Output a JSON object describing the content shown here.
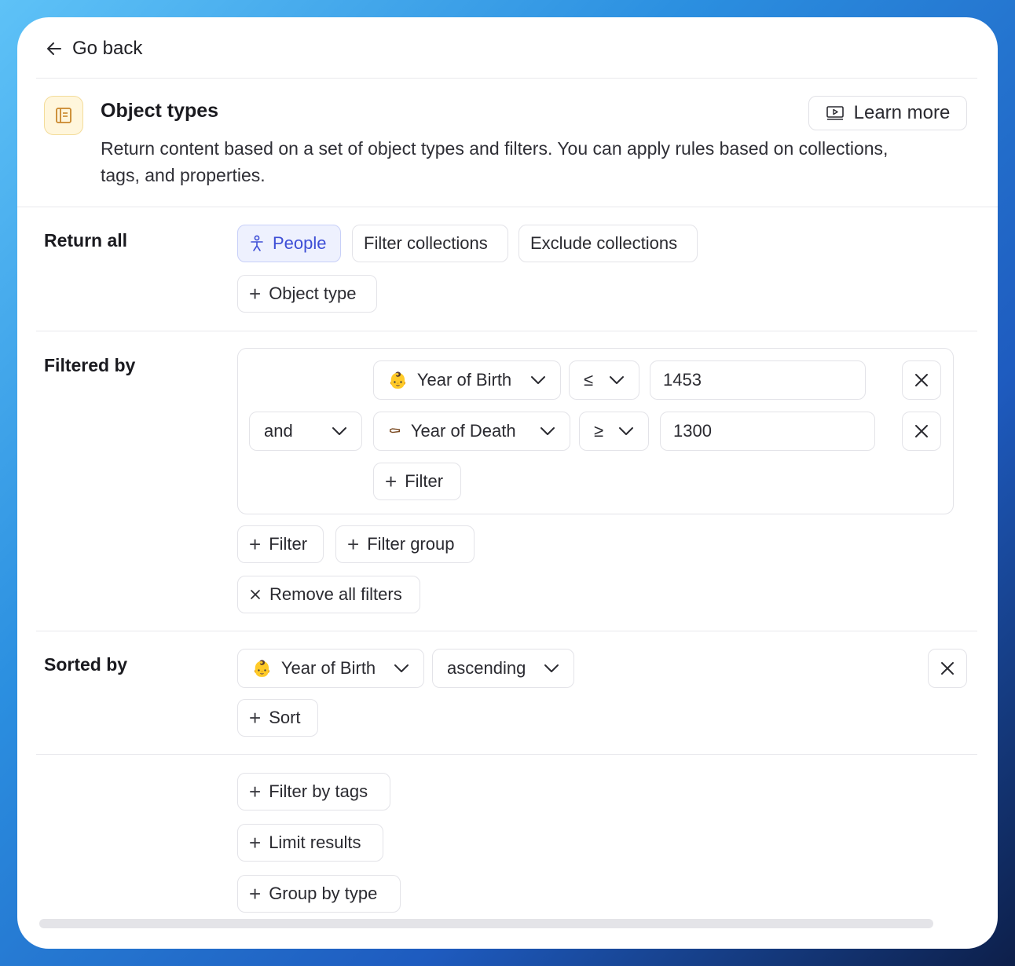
{
  "nav": {
    "go_back": "Go back"
  },
  "header": {
    "title": "Object types",
    "description": "Return content based on a set of object types and filters. You can apply rules based on collections, tags, and properties.",
    "learn_more": "Learn more"
  },
  "return_all": {
    "label": "Return all",
    "chips": [
      "People",
      "Filter collections",
      "Exclude collections"
    ],
    "add_object_type": "Object type"
  },
  "filtered_by": {
    "label": "Filtered by",
    "rows": [
      {
        "property": "Year of Birth",
        "property_icon": "👶",
        "operator": "≤",
        "value": "1453"
      },
      {
        "conjunction": "and",
        "property": "Year of Death",
        "property_icon": "⚰",
        "operator": "≥",
        "value": "1300"
      }
    ],
    "group_add_filter": "Filter",
    "add_filter": "Filter",
    "add_filter_group": "Filter group",
    "remove_all": "Remove all filters"
  },
  "sorted_by": {
    "label": "Sorted by",
    "property": "Year of Birth",
    "property_icon": "👶",
    "direction": "ascending",
    "add_sort": "Sort"
  },
  "extra": {
    "filter_by_tags": "Filter by tags",
    "limit_results": "Limit results",
    "group_by_type": "Group by type"
  },
  "colors": {
    "accent": "#3e4fd6",
    "accent_bg": "#eef1fe",
    "border": "#e3e3e8"
  }
}
